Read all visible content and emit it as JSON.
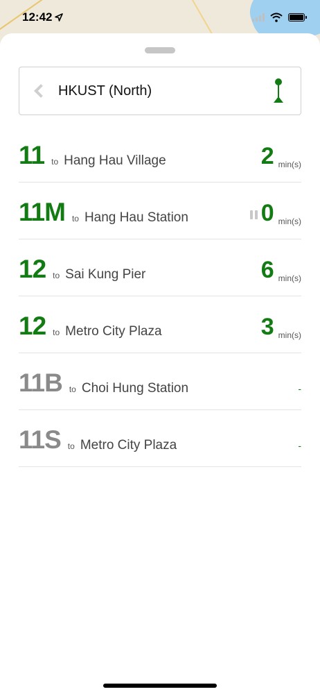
{
  "status_bar": {
    "time": "12:42"
  },
  "stop": {
    "name": "HKUST (North)"
  },
  "routes": [
    {
      "route": "11",
      "to": "to",
      "destination": "Hang Hau Village",
      "eta": "2",
      "unit": "min(s)",
      "active": true,
      "paused": false
    },
    {
      "route": "11M",
      "to": "to",
      "destination": "Hang Hau Station",
      "eta": "0",
      "unit": "min(s)",
      "active": true,
      "paused": true
    },
    {
      "route": "12",
      "to": "to",
      "destination": "Sai Kung Pier",
      "eta": "6",
      "unit": "min(s)",
      "active": true,
      "paused": false
    },
    {
      "route": "12",
      "to": "to",
      "destination": "Metro City Plaza",
      "eta": "3",
      "unit": "min(s)",
      "active": true,
      "paused": false
    },
    {
      "route": "11B",
      "to": "to",
      "destination": "Choi Hung Station",
      "eta": "-",
      "unit": "",
      "active": false,
      "paused": false
    },
    {
      "route": "11S",
      "to": "to",
      "destination": "Metro City Plaza",
      "eta": "-",
      "unit": "",
      "active": false,
      "paused": false
    }
  ],
  "colors": {
    "active_route": "#137b13",
    "inactive_route": "#8a8a8a"
  }
}
